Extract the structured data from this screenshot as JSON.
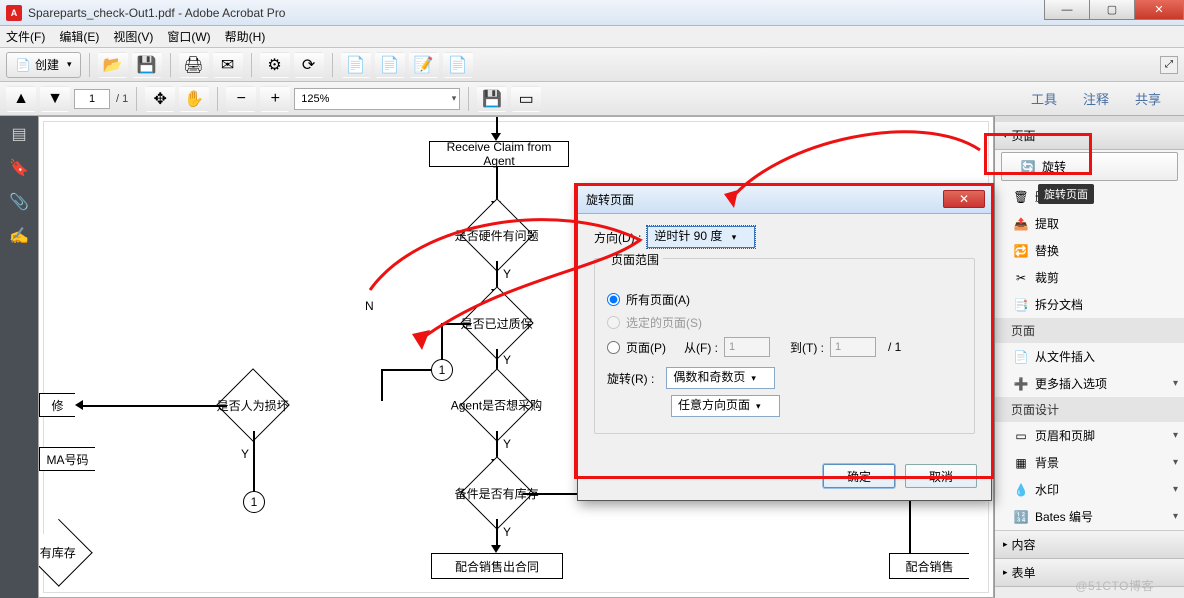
{
  "window": {
    "title": "Spareparts_check-Out1.pdf - Adobe Acrobat Pro",
    "minimize": "—",
    "maximize": "▢",
    "close": "✕"
  },
  "menu": {
    "file": "文件(F)",
    "edit": "编辑(E)",
    "view": "视图(V)",
    "window": "窗口(W)",
    "help": "帮助(H)"
  },
  "toolbar": {
    "create": "创建",
    "page_current": "1",
    "page_total": "/ 1",
    "zoom": "125%"
  },
  "right_tabs": {
    "tools": "工具",
    "comment": "注释",
    "share": "共享"
  },
  "flow": {
    "receive": "Receive Claim from Agent",
    "hw": "是否硬件有问题",
    "warranty": "是否已过质保",
    "human": "是否人为损坏",
    "agent_buy": "Agent是否想采购",
    "stock": "备件是否有库存",
    "repair": "修",
    "ma": "MA号码",
    "stock2": "有库存",
    "sell": "配合销售出合同",
    "sell2": "配合销售",
    "Y": "Y",
    "N": "N",
    "one": "1"
  },
  "panel": {
    "pages_hdr": "页面",
    "rotate": "旋转",
    "rotate_tip": "旋转页面",
    "delete": "删除",
    "extract": "提取",
    "replace": "替换",
    "crop": "裁剪",
    "split": "拆分文档",
    "insert_hdr": "页面",
    "insert_file": "从文件插入",
    "more_insert": "更多插入选项",
    "design_hdr": "页面设计",
    "header_footer": "页眉和页脚",
    "background": "背景",
    "watermark": "水印",
    "bates": "Bates 编号",
    "content": "内容",
    "form": "表单"
  },
  "dialog": {
    "title": "旋转页面",
    "dir_label": "方向(D) :",
    "dir_value": "逆时针 90 度",
    "range_legend": "页面范围",
    "all": "所有页面(A)",
    "selected": "选定的页面(S)",
    "pages": "页面(P)",
    "from": "从(F) :",
    "from_val": "1",
    "to": "到(T) :",
    "to_val": "1",
    "of": "/ 1",
    "rotate_label": "旋转(R) :",
    "even_odd": "偶数和奇数页",
    "any_orient": "任意方向页面",
    "ok": "确定",
    "cancel": "取消"
  },
  "watermark": "@51CTO博客"
}
